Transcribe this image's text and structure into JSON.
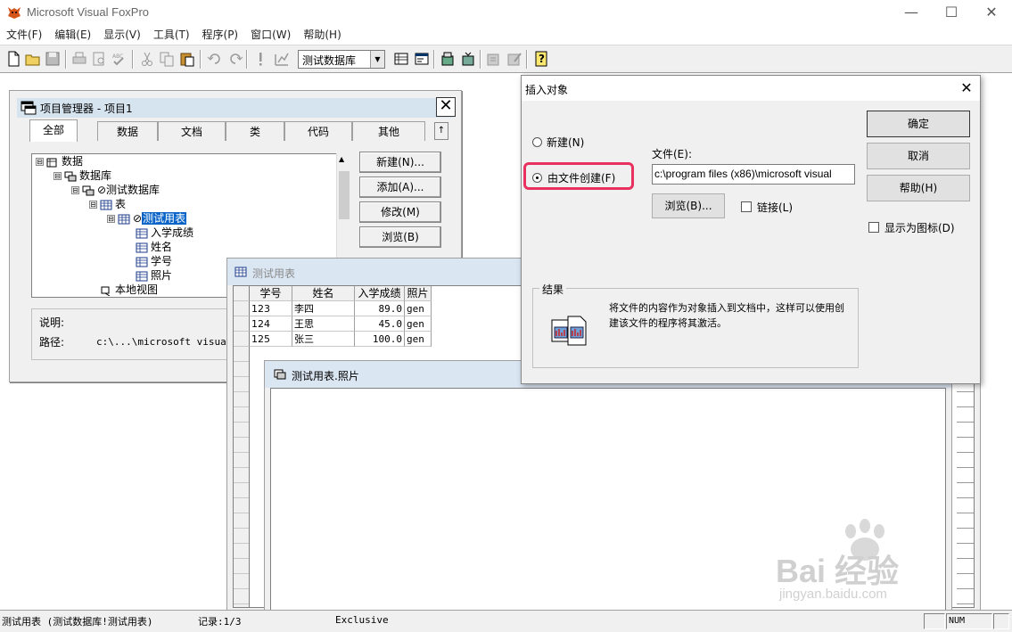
{
  "app": {
    "title": "Microsoft Visual FoxPro",
    "window_controls": {
      "minimize": "—",
      "maximize": "☐",
      "close": "✕"
    }
  },
  "menu": [
    "文件(F)",
    "编辑(E)",
    "显示(V)",
    "工具(T)",
    "程序(P)",
    "窗口(W)",
    "帮助(H)"
  ],
  "toolbar": {
    "database_combo": "测试数据库",
    "icons": [
      "new-file-icon",
      "open-folder-icon",
      "save-icon",
      "print-icon",
      "print-preview-icon",
      "spell-check-icon",
      "cut-icon",
      "copy-icon",
      "paste-icon",
      "undo-icon",
      "redo-icon",
      "run-icon",
      "modify-form-icon",
      "database-window-icon",
      "command-window-icon",
      "data-session-icon",
      "form-wizard-icon",
      "report-wizard-icon",
      "help-icon"
    ]
  },
  "project_manager": {
    "title": "项目管理器 - 项目1",
    "close": "✕",
    "tabs": [
      "全部",
      "数据",
      "文档",
      "类",
      "代码",
      "其他"
    ],
    "tab_scroll": "↑",
    "tree": [
      {
        "label": "数据",
        "expander": "⊟"
      },
      {
        "label": "数据库",
        "expander": "⊟"
      },
      {
        "label": "⊘测试数据库",
        "expander": "⊟"
      },
      {
        "label": "表",
        "expander": "⊟"
      },
      {
        "label": "测试用表",
        "prefix": "⊘",
        "expander": "⊟"
      },
      {
        "label": "入学成绩",
        "expander": ""
      },
      {
        "label": "姓名",
        "expander": ""
      },
      {
        "label": "学号",
        "expander": ""
      },
      {
        "label": "照片",
        "expander": ""
      },
      {
        "label": "本地视图",
        "expander": ""
      }
    ],
    "buttons": [
      "新建(N)...",
      "添加(A)...",
      "修改(M)",
      "浏览(B)"
    ],
    "info": {
      "desc_label": "说明:",
      "path_label": "路径:",
      "path_value": "c:\\...\\microsoft visual s"
    }
  },
  "browse_window": {
    "title": "测试用表",
    "columns": [
      "学号",
      "姓名",
      "入学成绩",
      "照片"
    ],
    "rows": [
      {
        "id": "123",
        "name": "李四",
        "score": "89.0",
        "photo": "gen"
      },
      {
        "id": "124",
        "name": "王思",
        "score": "45.0",
        "photo": "gen"
      },
      {
        "id": "125",
        "name": "张三",
        "score": "100.0",
        "photo": "gen"
      }
    ]
  },
  "memo_window": {
    "title": "测试用表.照片"
  },
  "insert_dialog": {
    "title": "插入对象",
    "close": "✕",
    "radio_new": "新建(N)",
    "radio_from_file": "由文件创建(F)",
    "file_label": "文件(E):",
    "file_value": "c:\\program files (x86)\\microsoft visual",
    "browse_button": "浏览(B)...",
    "link_label": "链接(L)",
    "ok_button": "确定",
    "cancel_button": "取消",
    "help_button": "帮助(H)",
    "show_as_icon_label": "显示为图标(D)",
    "result_label": "结果",
    "result_text": "将文件的内容作为对象插入到文档中，这样可以使用创建该文件的程序将其激活。"
  },
  "status": {
    "table": "测试用表 (测试数据库!测试用表)",
    "record": "记录:1/3",
    "mode": "Exclusive",
    "num": "NUM"
  },
  "watermark": {
    "brand": "Bai  经验",
    "url": "jingyan.baidu.com"
  },
  "colors": {
    "highlight": "#e8315f",
    "selection": "#0a64c8",
    "title_inactive": "#dbe6f3"
  }
}
